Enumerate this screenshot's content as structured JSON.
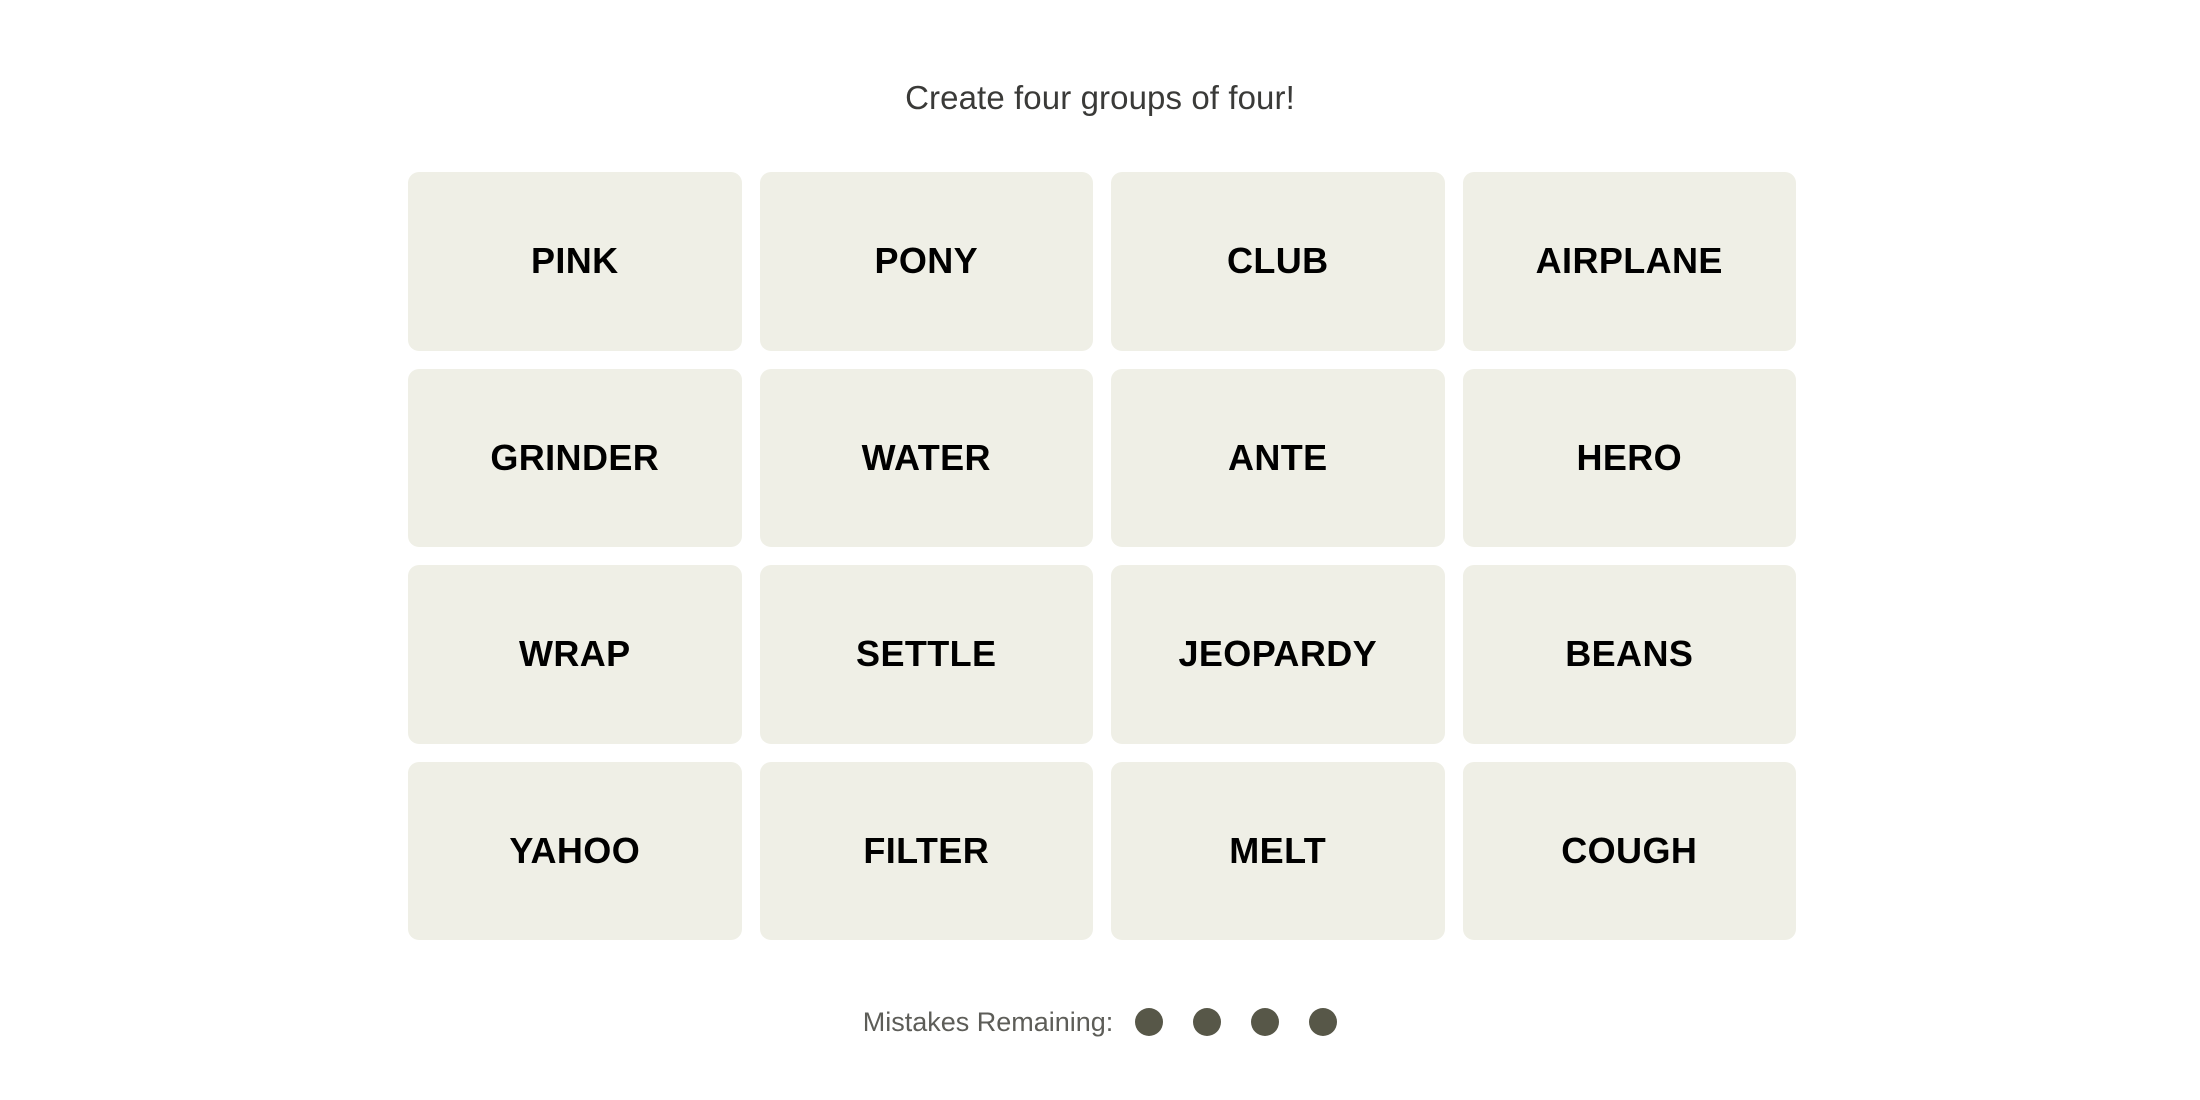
{
  "page": {
    "background_color": "#ffffff",
    "title": "Create four groups of four!"
  },
  "board": {
    "rows": 4,
    "columns": 4,
    "tile_background_color": "#efefe6",
    "tile_text_color": "#000000",
    "tiles": [
      {
        "label": "PINK",
        "row": 1,
        "column": 1
      },
      {
        "label": "PONY",
        "row": 1,
        "column": 2
      },
      {
        "label": "CLUB",
        "row": 1,
        "column": 3
      },
      {
        "label": "AIRPLANE",
        "row": 1,
        "column": 4
      },
      {
        "label": "GRINDER",
        "row": 2,
        "column": 1
      },
      {
        "label": "WATER",
        "row": 2,
        "column": 2
      },
      {
        "label": "ANTE",
        "row": 2,
        "column": 3
      },
      {
        "label": "HERO",
        "row": 2,
        "column": 4
      },
      {
        "label": "WRAP",
        "row": 3,
        "column": 1
      },
      {
        "label": "SETTLE",
        "row": 3,
        "column": 2
      },
      {
        "label": "JEOPARDY",
        "row": 3,
        "column": 3
      },
      {
        "label": "BEANS",
        "row": 3,
        "column": 4
      },
      {
        "label": "YAHOO",
        "row": 4,
        "column": 1
      },
      {
        "label": "FILTER",
        "row": 4,
        "column": 2
      },
      {
        "label": "MELT",
        "row": 4,
        "column": 3
      },
      {
        "label": "COUGH",
        "row": 4,
        "column": 4
      }
    ]
  },
  "footer": {
    "mistakes_label": "Mistakes Remaining:",
    "mistakes_remaining": 4,
    "dot_color": "#575748",
    "label_color": "#5d5d58"
  }
}
